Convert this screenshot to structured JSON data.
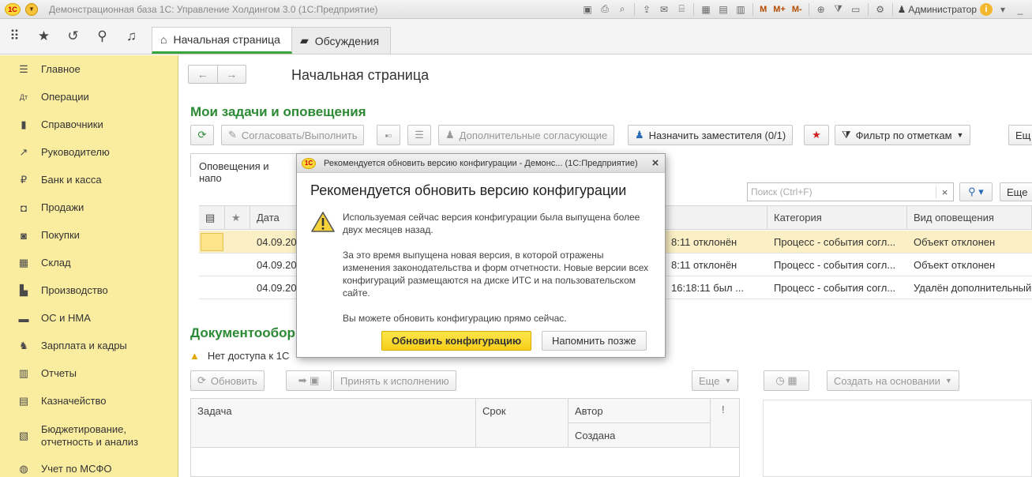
{
  "app": {
    "title": "Демонстрационная база 1С: Управление Холдингом 3.0  (1С:Предприятие)",
    "logo_text": "1С",
    "toolbar_m_labels": [
      "M",
      "M+",
      "M-"
    ],
    "user": "Администратор"
  },
  "tabs": [
    {
      "label": "Начальная страница",
      "icon": "home-icon",
      "active": true
    },
    {
      "label": "Обсуждения",
      "icon": "chat-icon",
      "active": false
    }
  ],
  "sidebar": {
    "items": [
      {
        "label": "Главное",
        "icon": "menu-icon"
      },
      {
        "label": "Операции",
        "icon": "operations-icon"
      },
      {
        "label": "Справочники",
        "icon": "book-icon"
      },
      {
        "label": "Руководителю",
        "icon": "trend-icon"
      },
      {
        "label": "Банк и касса",
        "icon": "ruble-icon"
      },
      {
        "label": "Продажи",
        "icon": "bag-icon"
      },
      {
        "label": "Покупки",
        "icon": "cart-icon"
      },
      {
        "label": "Склад",
        "icon": "warehouse-icon"
      },
      {
        "label": "Производство",
        "icon": "factory-icon"
      },
      {
        "label": "ОС и НМА",
        "icon": "truck-icon"
      },
      {
        "label": "Зарплата и кадры",
        "icon": "people-icon"
      },
      {
        "label": "Отчеты",
        "icon": "chart-icon"
      },
      {
        "label": "Казначейство",
        "icon": "treasury-icon"
      },
      {
        "label": "Бюджетирование, отчетность и анализ",
        "icon": "budget-icon"
      },
      {
        "label": "Учет по МСФО",
        "icon": "globe-icon"
      }
    ]
  },
  "page": {
    "title": "Начальная страница",
    "tasks_section": "Мои задачи и оповещения",
    "docflow_section": "Документообор"
  },
  "tasks_toolbar": {
    "approve": "Согласовать/Выполнить",
    "additional": "Дополнительные согласующие",
    "assign_deputy": "Назначить заместителя (0/1)",
    "filter": "Фильтр по отметкам",
    "more_cut": "Ещ"
  },
  "notifications": {
    "tab_label": "Оповещения и напо",
    "search_placeholder": "Поиск (Ctrl+F)",
    "more_cut": "Еще",
    "columns": [
      "Дата",
      "Категория",
      "Вид оповещения"
    ],
    "rows": [
      {
        "date": "04.09.20",
        "tail": "8:11 отклонён",
        "category": "Процесс - события согл...",
        "kind": "Объект отклонен"
      },
      {
        "date": "04.09.20",
        "tail": "8:11 отклонён",
        "category": "Процесс - события согл...",
        "kind": "Объект отклонен"
      },
      {
        "date": "04.09.20",
        "tail": "16:18:11 был ...",
        "category": "Процесс - события согл...",
        "kind": "Удалён дополнительный..."
      }
    ]
  },
  "docflow": {
    "warning": "Нет доступа к 1С",
    "refresh": "Обновить",
    "accept": "Принять к исполнению",
    "more": "Еще",
    "create_based": "Создать на основании",
    "columns": {
      "task": "Задача",
      "due": "Срок",
      "author": "Автор",
      "created": "Создана",
      "flag": "!"
    }
  },
  "modal": {
    "window_title": "Рекомендуется обновить версию конфигурации - Демонс...  (1С:Предприятие)",
    "heading": "Рекомендуется обновить версию конфигурации",
    "p1": "Используемая сейчас версия конфигурации была выпущена более двух месяцев назад.",
    "p2": "За это время выпущена новая версия, в которой отражены изменения законодательства и форм отчетности. Новые версии всех конфигураций размещаются на диске ИТС и на пользовательском сайте.",
    "p3": "Вы можете обновить конфигурацию прямо сейчас.",
    "update_button": "Обновить конфигурацию",
    "later_button": "Напомнить позже"
  }
}
